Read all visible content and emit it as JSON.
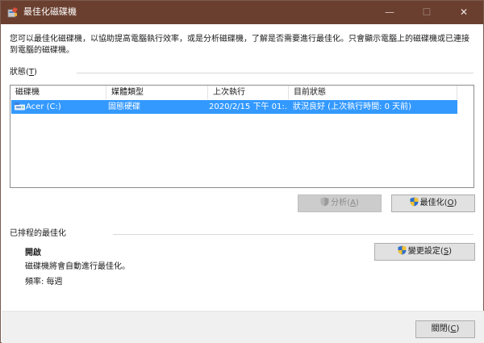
{
  "window": {
    "title": "最佳化磁碟機",
    "minimize_glyph": "—",
    "maximize_glyph": "☐",
    "close_glyph": "✕"
  },
  "description": "您可以最佳化磁碟機，以協助提高電腦執行效率，或是分析磁碟機，了解是否需要進行最佳化。只會顯示電腦上的磁碟機或已連接到電腦的磁碟機。",
  "status_group": {
    "label_prefix": "狀態(",
    "label_key": "T",
    "label_suffix": ")"
  },
  "drive_list": {
    "columns": [
      "磁碟機",
      "媒體類型",
      "上次執行",
      "目前狀態"
    ],
    "rows": [
      {
        "drive": "Acer (C:)",
        "media_type": "固態硬碟",
        "last_run": "2020/2/15 下午 01:...",
        "status": "狀況良好 (上次執行時間: 0 天前)",
        "icon": "drive-icon"
      }
    ]
  },
  "buttons": {
    "analyze": {
      "label": "分析(",
      "key": "A",
      "suffix": ")",
      "enabled": false
    },
    "optimize": {
      "label": "最佳化(",
      "key": "O",
      "suffix": ")",
      "enabled": true
    },
    "change_settings": {
      "label": "變更設定(",
      "key": "S",
      "suffix": ")",
      "enabled": true
    },
    "close": {
      "label": "關閉(",
      "key": "C",
      "suffix": ")",
      "enabled": true
    }
  },
  "schedule_group": {
    "label": "已排程的最佳化",
    "state": "開啟",
    "description": "磁碟機將會自動進行最佳化。",
    "frequency": "頻率: 每週"
  },
  "colors": {
    "titlebar": "#6b3f2f",
    "selection": "#3399ff",
    "shield_blue": "#2f6fc9",
    "shield_yellow": "#f2c230"
  }
}
